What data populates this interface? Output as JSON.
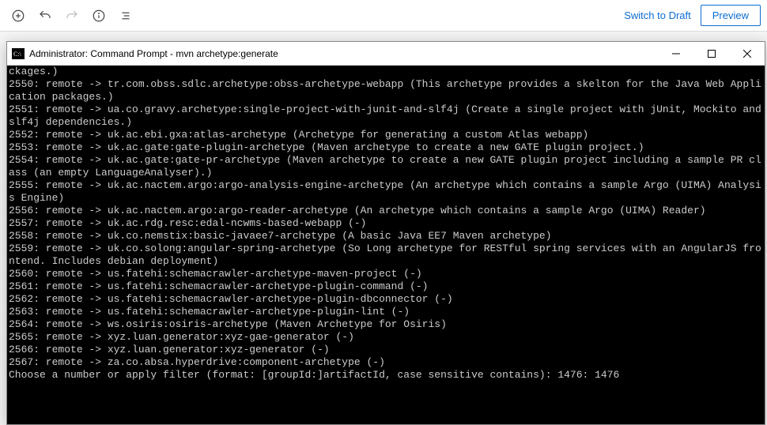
{
  "toolbar": {
    "switch_label": "Switch to Draft",
    "preview_label": "Preview"
  },
  "window": {
    "title": "Administrator: Command Prompt - mvn  archetype:generate"
  },
  "terminal_lines": [
    "ckages.)",
    "2550: remote -> tr.com.obss.sdlc.archetype:obss-archetype-webapp (This archetype provides a skelton for the Java Web Application packages.)",
    "2551: remote -> ua.co.gravy.archetype:single-project-with-junit-and-slf4j (Create a single project with jUnit, Mockito and slf4j dependencies.)",
    "2552: remote -> uk.ac.ebi.gxa:atlas-archetype (Archetype for generating a custom Atlas webapp)",
    "2553: remote -> uk.ac.gate:gate-plugin-archetype (Maven archetype to create a new GATE plugin project.)",
    "2554: remote -> uk.ac.gate:gate-pr-archetype (Maven archetype to create a new GATE plugin project including a sample PR class (an empty LanguageAnalyser).)",
    "2555: remote -> uk.ac.nactem.argo:argo-analysis-engine-archetype (An archetype which contains a sample Argo (UIMA) Analysis Engine)",
    "2556: remote -> uk.ac.nactem.argo:argo-reader-archetype (An archetype which contains a sample Argo (UIMA) Reader)",
    "2557: remote -> uk.ac.rdg.resc:edal-ncwms-based-webapp (-)",
    "2558: remote -> uk.co.nemstix:basic-javaee7-archetype (A basic Java EE7 Maven archetype)",
    "2559: remote -> uk.co.solong:angular-spring-archetype (So Long archetype for RESTful spring services with an AngularJS frontend. Includes debian deployment)",
    "2560: remote -> us.fatehi:schemacrawler-archetype-maven-project (-)",
    "2561: remote -> us.fatehi:schemacrawler-archetype-plugin-command (-)",
    "2562: remote -> us.fatehi:schemacrawler-archetype-plugin-dbconnector (-)",
    "2563: remote -> us.fatehi:schemacrawler-archetype-plugin-lint (-)",
    "2564: remote -> ws.osiris:osiris-archetype (Maven Archetype for Osiris)",
    "2565: remote -> xyz.luan.generator:xyz-gae-generator (-)",
    "2566: remote -> xyz.luan.generator:xyz-generator (-)",
    "2567: remote -> za.co.absa.hyperdrive:component-archetype (-)",
    "Choose a number or apply filter (format: [groupId:]artifactId, case sensitive contains): 1476: 1476"
  ]
}
